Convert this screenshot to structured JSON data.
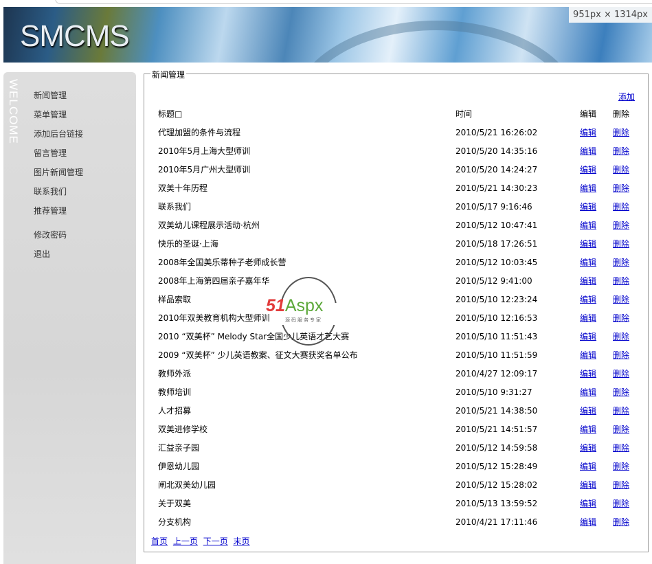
{
  "header": {
    "logo": "SMCMS",
    "size_badge": "951px × 1314px"
  },
  "sidebar": {
    "welcome": "WELCOME",
    "items": [
      {
        "label": "新闻管理"
      },
      {
        "label": "菜单管理"
      },
      {
        "label": "添加后台链接"
      },
      {
        "label": "留言管理"
      },
      {
        "label": "图片新闻管理"
      },
      {
        "label": "联系我们"
      },
      {
        "label": "推荐管理"
      },
      {
        "label": "修改密码"
      },
      {
        "label": "退出"
      }
    ]
  },
  "main": {
    "legend": "新闻管理",
    "add_label": "添加",
    "columns": {
      "title": "标题□",
      "time": "时间",
      "edit": "编辑",
      "delete": "删除"
    },
    "rows": [
      {
        "title": "代理加盟的条件与流程",
        "time": "2010/5/21 16:26:02"
      },
      {
        "title": "2010年5月上海大型师训",
        "time": "2010/5/20 14:35:16"
      },
      {
        "title": "2010年5月广州大型师训",
        "time": "2010/5/20 14:24:27"
      },
      {
        "title": "双美十年历程",
        "time": "2010/5/21 14:30:23"
      },
      {
        "title": "联系我们",
        "time": "2010/5/17 9:16:46"
      },
      {
        "title": "双美幼儿课程展示活动·杭州",
        "time": "2010/5/12 10:47:41"
      },
      {
        "title": "快乐的圣诞·上海",
        "time": "2010/5/18 17:26:51"
      },
      {
        "title": "2008年全国美乐蒂种子老师成长营",
        "time": "2010/5/12 10:03:45"
      },
      {
        "title": "2008年上海第四届亲子嘉年华",
        "time": "2010/5/12 9:41:00"
      },
      {
        "title": "样品索取",
        "time": "2010/5/10 12:23:24"
      },
      {
        "title": "2010年双美教育机构大型师训",
        "time": "2010/5/10 12:16:53"
      },
      {
        "title": "2010 “双美杯” Melody Star全国少儿英语才艺大赛",
        "time": "2010/5/10 11:51:43"
      },
      {
        "title": "2009 “双美杯” 少儿英语教案、征文大赛获奖名单公布",
        "time": "2010/5/10 11:51:59"
      },
      {
        "title": "教师外派",
        "time": "2010/4/27 12:09:17"
      },
      {
        "title": "教师培训",
        "time": "2010/5/10 9:31:27"
      },
      {
        "title": "人才招募",
        "time": "2010/5/21 14:38:50"
      },
      {
        "title": "双美进修学校",
        "time": "2010/5/21 14:51:57"
      },
      {
        "title": "汇益亲子园",
        "time": "2010/5/12 14:59:58"
      },
      {
        "title": "伊恩幼儿园",
        "time": "2010/5/12 15:28:49"
      },
      {
        "title": "闸北双美幼儿园",
        "time": "2010/5/12 15:28:02"
      },
      {
        "title": "关于双美",
        "time": "2010/5/13 13:59:52"
      },
      {
        "title": "分支机构",
        "time": "2010/4/21 17:11:46"
      }
    ],
    "row_edit": "编辑",
    "row_delete": "删除",
    "pager": {
      "first": "首页",
      "prev": "上一页",
      "next": "下一页",
      "last": "末页"
    }
  },
  "watermark": {
    "brand": "51",
    "brand2": "Aspx",
    "slogan": "源码服务专家"
  }
}
